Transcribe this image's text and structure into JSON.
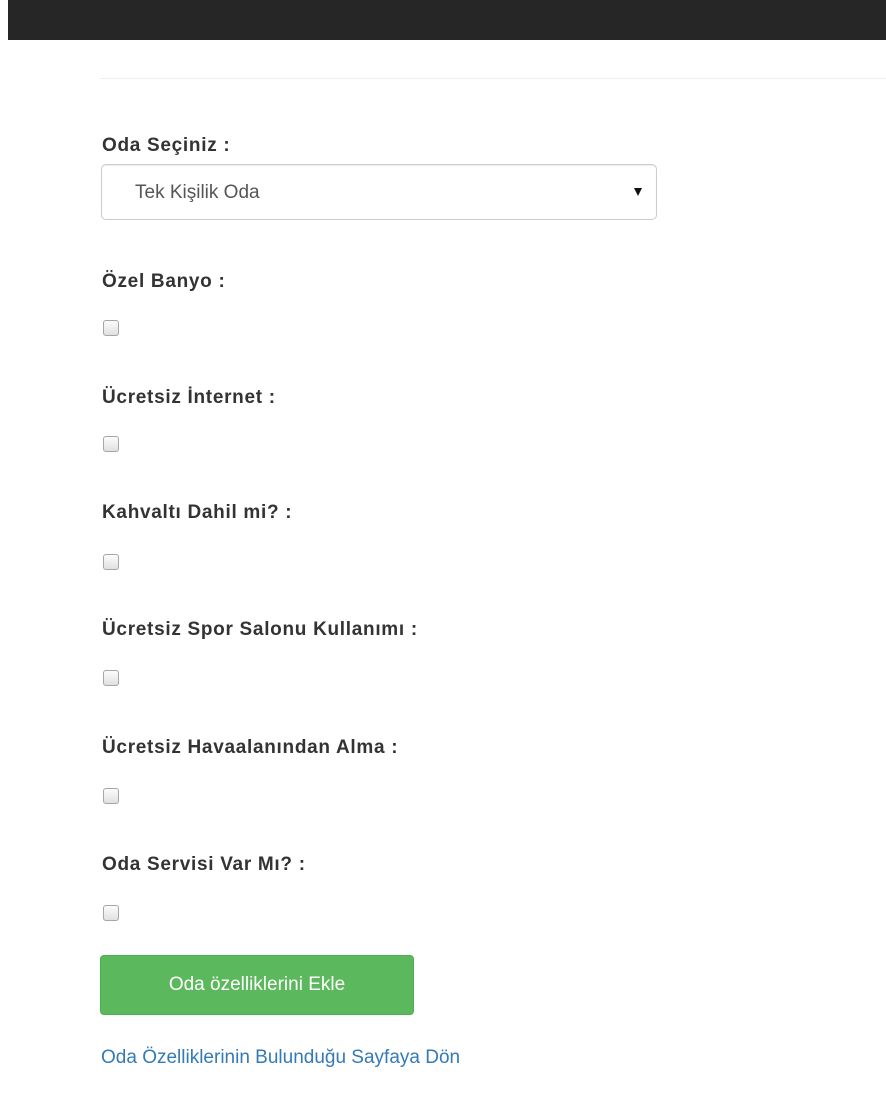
{
  "form": {
    "room_select": {
      "label": "Oda Seçiniz :",
      "value": "Tek Kişilik Oda"
    },
    "features": [
      {
        "label": "Özel Banyo :",
        "checked": false
      },
      {
        "label": "Ücretsiz İnternet :",
        "checked": false
      },
      {
        "label": "Kahvaltı Dahil mi? :",
        "checked": false
      },
      {
        "label": "Ücretsiz Spor Salonu Kullanımı :",
        "checked": false
      },
      {
        "label": "Ücretsiz Havaalanından Alma :",
        "checked": false
      },
      {
        "label": "Oda Servisi Var Mı? :",
        "checked": false
      }
    ],
    "submit_label": "Oda özelliklerini Ekle",
    "back_link_label": "Oda Özelliklerinin Bulunduğu Sayfaya Dön"
  },
  "colors": {
    "topbar": "#262626",
    "submit_button": "#5cb85c",
    "link": "#337ab7"
  }
}
